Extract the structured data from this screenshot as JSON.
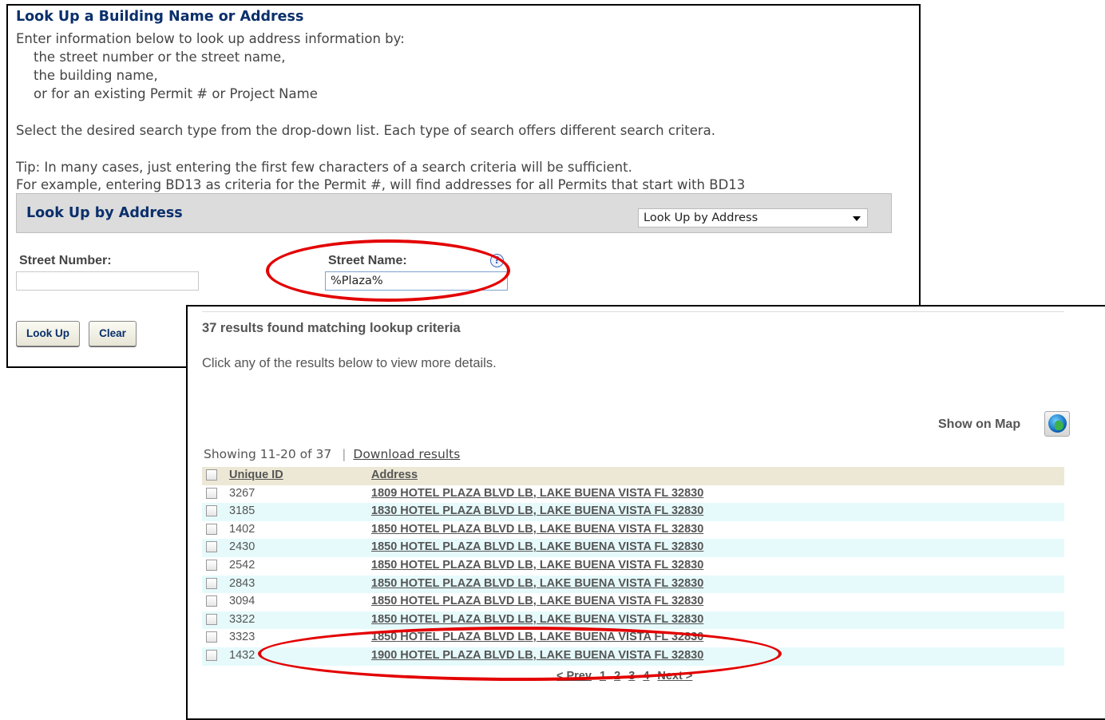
{
  "lookup": {
    "title": "Look Up a Building Name or Address",
    "intro": "Enter information below to look up address information by:",
    "options": [
      "the street number or the street name,",
      "the building name,",
      "or for an existing Permit # or Project Name"
    ],
    "instruction": "Select the desired search type from the drop-down list. Each type of search offers different search critera.",
    "tip1": "Tip: In many cases, just entering the first few characters of a search criteria will be sufficient.",
    "tip2": "For example, entering BD13 as criteria for the Permit #, will find addresses for all Permits that start with BD13",
    "section_title": "Look Up by Address",
    "search_type": "Look Up by Address",
    "street_number_label": "Street Number:",
    "street_number_value": "",
    "street_name_label": "Street Name:",
    "street_name_value": "%Plaza%",
    "help_glyph": "?",
    "lookup_button": "Look Up",
    "clear_button": "Clear"
  },
  "results": {
    "title": "37 results found matching lookup criteria",
    "subtitle": "Click any of the results below to view more details.",
    "show_on_map": "Show on Map",
    "showing": "Showing 11-20 of 37",
    "separator": "|",
    "download": "Download results",
    "columns": [
      "Unique ID",
      "Address"
    ],
    "rows": [
      {
        "id": "3267",
        "address": "1809 HOTEL PLAZA BLVD LB, LAKE BUENA VISTA FL 32830"
      },
      {
        "id": "3185",
        "address": "1830 HOTEL PLAZA BLVD LB, LAKE BUENA VISTA FL 32830"
      },
      {
        "id": "1402",
        "address": "1850 HOTEL PLAZA BLVD LB, LAKE BUENA VISTA FL 32830"
      },
      {
        "id": "2430",
        "address": "1850 HOTEL PLAZA BLVD LB, LAKE BUENA VISTA FL 32830"
      },
      {
        "id": "2542",
        "address": "1850 HOTEL PLAZA BLVD LB, LAKE BUENA VISTA FL 32830"
      },
      {
        "id": "2843",
        "address": "1850 HOTEL PLAZA BLVD LB, LAKE BUENA VISTA FL 32830"
      },
      {
        "id": "3094",
        "address": "1850 HOTEL PLAZA BLVD LB, LAKE BUENA VISTA FL 32830"
      },
      {
        "id": "3322",
        "address": "1850 HOTEL PLAZA BLVD LB, LAKE BUENA VISTA FL 32830"
      },
      {
        "id": "3323",
        "address": "1850 HOTEL PLAZA BLVD LB, LAKE BUENA VISTA FL 32830"
      },
      {
        "id": "1432",
        "address": "1900 HOTEL PLAZA BLVD LB, LAKE BUENA VISTA FL 32830"
      }
    ],
    "pager": {
      "prev": "< Prev",
      "pages": [
        "1",
        "2",
        "3",
        "4"
      ],
      "next": "Next >"
    }
  },
  "colors": {
    "annotation": "#e30000",
    "heading": "#0a2f6b",
    "row_alt": "#e6fafc",
    "header_bg": "#ede8d5"
  }
}
